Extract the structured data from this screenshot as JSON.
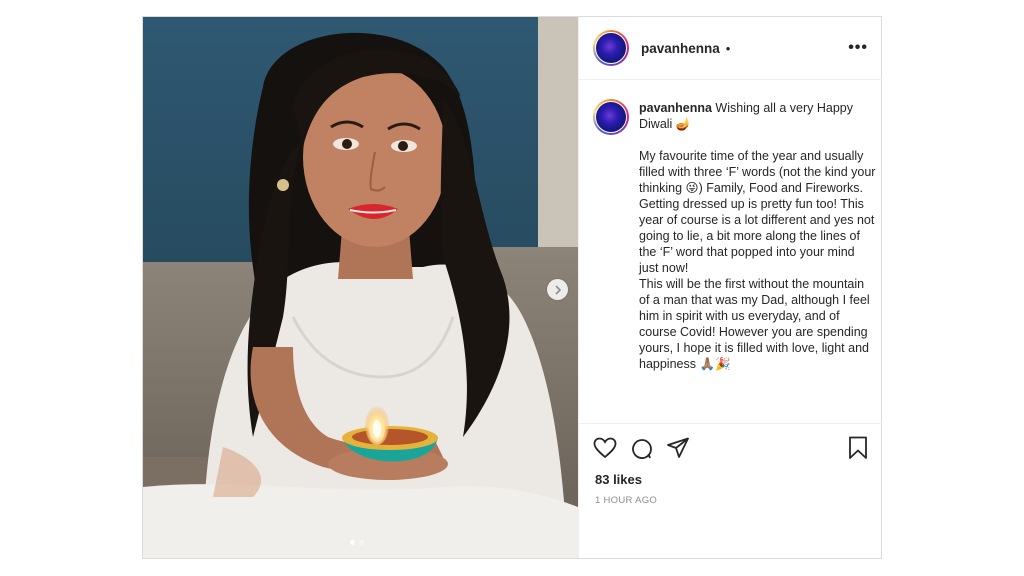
{
  "post": {
    "username": "pavanhenna",
    "separator": "•",
    "more_label": "•••",
    "caption": {
      "username": "pavanhenna",
      "first_line": "Wishing all a very Happy Diwali 🪔",
      "paragraph_1": "My favourite time of the year and usually filled with three ‘F’ words (not the kind your thinking 😜) Family, Food and Fireworks. Getting dressed up is pretty fun too! This year of course is a lot different and yes not going to lie, a bit more along the lines of the ‘F’ word that popped into your mind just now!",
      "paragraph_2": "This will be the first without the mountain of a man that was my Dad, although I feel him in spirit with us everyday, and of course Covid! However you are spending yours, I hope it is filled with love, light and happiness 🙏🏽🎉"
    },
    "likes": "83 likes",
    "timestamp": "1 HOUR AGO",
    "carousel": {
      "slide_count": 2,
      "current": 1
    }
  },
  "colors": {
    "text": "#262626",
    "muted": "#8e8e8e",
    "border": "#dbdbdb",
    "lipstick": "#d8262e"
  }
}
